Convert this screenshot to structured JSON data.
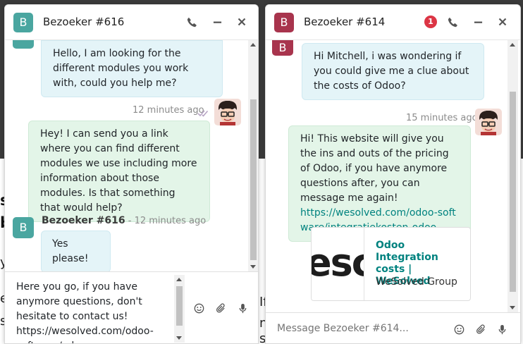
{
  "background": {
    "fragments": [
      "s",
      "b",
      "y",
      "e",
      "s",
      "If",
      "n",
      "s"
    ]
  },
  "left_chat": {
    "title": "Bezoeker #616",
    "avatar_letter": "B",
    "messages": [
      {
        "text": "Hello, I am looking for the different modules you work with, could you help me?"
      },
      {
        "time": "12 minutes ago",
        "text": "Hey! I can send you a link where you can find different modules we use including more information about those modules. Is that something that would help?"
      },
      {
        "author": "Bezoeker #616",
        "separator": " - ",
        "time": "12 minutes ago",
        "text": "Yes please!"
      }
    ],
    "composer": {
      "text": "Here you go, if you have\nanymore questions, don't\nhesitate to contact us!\nhttps://wesolved.com/odoo-\nsoftware/odoo-apps"
    }
  },
  "right_chat": {
    "title": "Bezoeker #614",
    "avatar_letter": "B",
    "badge_count": "1",
    "messages": [
      {
        "text": "Hi Mitchell, i was wondering if you could give me a clue about the costs of Odoo?"
      },
      {
        "time": "15 minutes ago",
        "text": "Hi! This website will give you the ins and outs of the pricing of Odoo, if you have anymore questions after, you can message me again!",
        "link": "https://wesolved.com/odoo-software/integratiekosten-odoo"
      }
    ],
    "link_preview": {
      "thumb_text": "esc",
      "title": "Odoo Integration costs | WeSolved",
      "site": "WeSolved Group"
    },
    "composer": {
      "placeholder": "Message Bezoeker #614..."
    }
  },
  "icons": {
    "phone": "phone-icon",
    "minimize": "minimize-icon",
    "close": "close-icon",
    "emoji": "emoji-icon",
    "attach": "paperclip-icon",
    "mic": "microphone-icon",
    "read_receipt": "double-check-icon"
  },
  "colors": {
    "visitor_left": "#4aa6a0",
    "visitor_right": "#a8344d",
    "incoming_bubble": "#e4f4f8",
    "outgoing_bubble": "#e3f5e8",
    "link": "#00827f",
    "badge": "#dc3545"
  }
}
